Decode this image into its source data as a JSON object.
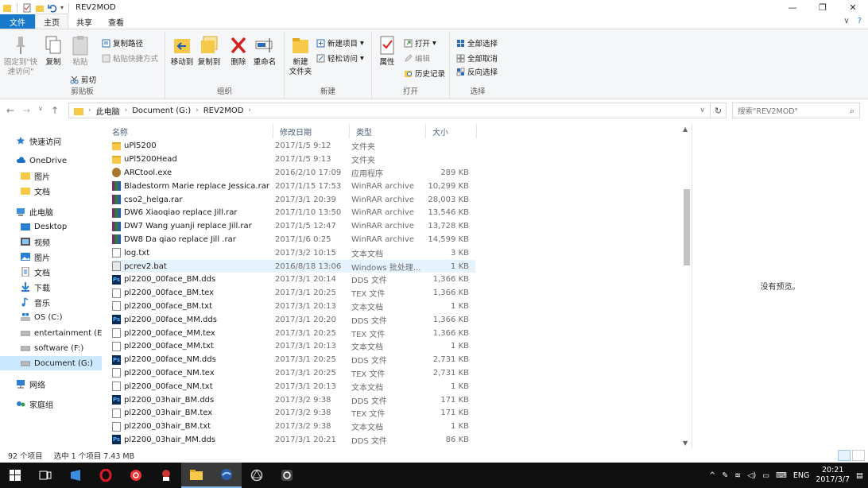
{
  "window": {
    "title": "REV2MOD",
    "minimize": "—",
    "restore": "❐",
    "close": "✕"
  },
  "tabs": [
    {
      "label": "文件"
    },
    {
      "label": "主页"
    },
    {
      "label": "共享"
    },
    {
      "label": "查看"
    }
  ],
  "ribbon": {
    "clipboard": {
      "pin": "固定到\"快\n速访问\"",
      "copy": "复制",
      "paste": "粘贴",
      "copy_path": "复制路径",
      "paste_shortcut": "粘贴快捷方式",
      "cut": "剪切",
      "label": "剪贴板"
    },
    "organize": {
      "move_to": "移动到",
      "copy_to": "复制到",
      "delete": "删除",
      "rename": "重命名",
      "label": "组织"
    },
    "new": {
      "new_folder": "新建\n文件夹",
      "new_item": "新建项目",
      "easy_access": "轻松访问",
      "label": "新建"
    },
    "open": {
      "properties": "属性",
      "open": "打开",
      "edit": "编辑",
      "history": "历史记录",
      "label": "打开"
    },
    "select": {
      "select_all": "全部选择",
      "select_none": "全部取消",
      "invert": "反向选择",
      "label": "选择"
    }
  },
  "address": {
    "crumbs": [
      "此电脑",
      "Document (G:)",
      "REV2MOD"
    ],
    "search_placeholder": "搜索\"REV2MOD\""
  },
  "nav": {
    "quick_access": "快速访问",
    "onedrive": "OneDrive",
    "od_pictures": "图片",
    "od_docs": "文档",
    "this_pc": "此电脑",
    "desktop": "Desktop",
    "videos": "视频",
    "pictures": "图片",
    "documents": "文档",
    "downloads": "下载",
    "music": "音乐",
    "os_c": "OS (C:)",
    "entertainment": "entertainment (E:",
    "software": "software (F:)",
    "document_g": "Document (G:)",
    "network": "网络",
    "homegroup": "家庭组"
  },
  "columns": {
    "name": "名称",
    "modified": "修改日期",
    "type": "类型",
    "size": "大小"
  },
  "files": [
    {
      "name": "uPl5200",
      "date": "2017/1/5 9:12",
      "type": "文件夹",
      "size": "",
      "icon": "folder"
    },
    {
      "name": "uPl5200Head",
      "date": "2017/1/5 9:13",
      "type": "文件夹",
      "size": "",
      "icon": "folder"
    },
    {
      "name": "ARCtool.exe",
      "date": "2016/2/10 17:09",
      "type": "应用程序",
      "size": "289 KB",
      "icon": "exe"
    },
    {
      "name": "Bladestorm Marie replace Jessica.rar",
      "date": "2017/1/15 17:53",
      "type": "WinRAR archive",
      "size": "10,299 KB",
      "icon": "rar"
    },
    {
      "name": "cso2_helga.rar",
      "date": "2017/3/1 20:39",
      "type": "WinRAR archive",
      "size": "28,003 KB",
      "icon": "rar"
    },
    {
      "name": "DW6 Xiaoqiao replace Jill.rar",
      "date": "2017/1/10 13:50",
      "type": "WinRAR archive",
      "size": "13,546 KB",
      "icon": "rar"
    },
    {
      "name": "DW7 Wang yuanji replace Jill.rar",
      "date": "2017/1/5 12:47",
      "type": "WinRAR archive",
      "size": "13,728 KB",
      "icon": "rar"
    },
    {
      "name": "DW8 Da qiao replace Jill .rar",
      "date": "2017/1/6 0:25",
      "type": "WinRAR archive",
      "size": "14,599 KB",
      "icon": "rar"
    },
    {
      "name": "log.txt",
      "date": "2017/3/2 10:15",
      "type": "文本文档",
      "size": "3 KB",
      "icon": "doc"
    },
    {
      "name": "pcrev2.bat",
      "date": "2016/8/18 13:06",
      "type": "Windows 批处理...",
      "size": "1 KB",
      "icon": "bat"
    },
    {
      "name": "pl2200_00face_BM.dds",
      "date": "2017/3/1 20:14",
      "type": "DDS 文件",
      "size": "1,366 KB",
      "icon": "ps"
    },
    {
      "name": "pl2200_00face_BM.tex",
      "date": "2017/3/1 20:25",
      "type": "TEX 文件",
      "size": "1,366 KB",
      "icon": "doc"
    },
    {
      "name": "pl2200_00face_BM.txt",
      "date": "2017/3/1 20:13",
      "type": "文本文档",
      "size": "1 KB",
      "icon": "doc"
    },
    {
      "name": "pl2200_00face_MM.dds",
      "date": "2017/3/1 20:20",
      "type": "DDS 文件",
      "size": "1,366 KB",
      "icon": "ps"
    },
    {
      "name": "pl2200_00face_MM.tex",
      "date": "2017/3/1 20:25",
      "type": "TEX 文件",
      "size": "1,366 KB",
      "icon": "doc"
    },
    {
      "name": "pl2200_00face_MM.txt",
      "date": "2017/3/1 20:13",
      "type": "文本文档",
      "size": "1 KB",
      "icon": "doc"
    },
    {
      "name": "pl2200_00face_NM.dds",
      "date": "2017/3/1 20:25",
      "type": "DDS 文件",
      "size": "2,731 KB",
      "icon": "ps"
    },
    {
      "name": "pl2200_00face_NM.tex",
      "date": "2017/3/1 20:25",
      "type": "TEX 文件",
      "size": "2,731 KB",
      "icon": "doc"
    },
    {
      "name": "pl2200_00face_NM.txt",
      "date": "2017/3/1 20:13",
      "type": "文本文档",
      "size": "1 KB",
      "icon": "doc"
    },
    {
      "name": "pl2200_03hair_BM.dds",
      "date": "2017/3/2 9:38",
      "type": "DDS 文件",
      "size": "171 KB",
      "icon": "ps"
    },
    {
      "name": "pl2200_03hair_BM.tex",
      "date": "2017/3/2 9:38",
      "type": "TEX 文件",
      "size": "171 KB",
      "icon": "doc"
    },
    {
      "name": "pl2200_03hair_BM.txt",
      "date": "2017/3/2 9:38",
      "type": "文本文档",
      "size": "1 KB",
      "icon": "doc"
    },
    {
      "name": "pl2200_03hair_MM.dds",
      "date": "2017/3/1 20:21",
      "type": "DDS 文件",
      "size": "86 KB",
      "icon": "ps"
    }
  ],
  "preview": {
    "message": "没有预览。"
  },
  "status": {
    "count": "92 个项目",
    "selected": "选中 1 个项目 7.43 MB"
  },
  "taskbar": {
    "lang": "ENG",
    "time": "20:21",
    "date": "2017/3/7"
  }
}
